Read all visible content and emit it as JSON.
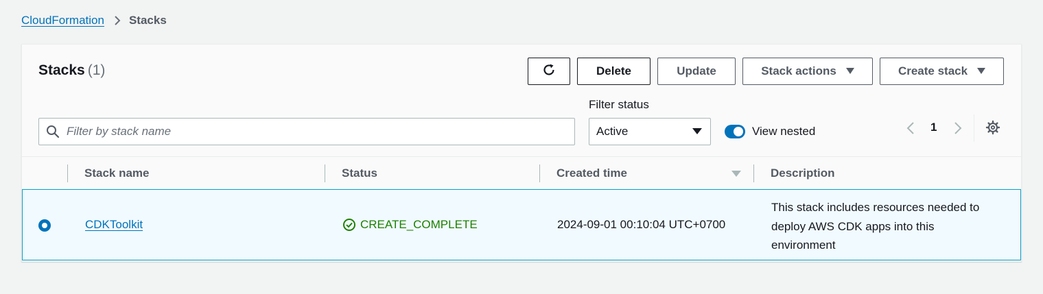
{
  "breadcrumb": {
    "root": "CloudFormation",
    "current": "Stacks"
  },
  "panel": {
    "title": "Stacks",
    "count": "(1)"
  },
  "toolbar": {
    "refresh_icon": "refresh-icon",
    "delete_label": "Delete",
    "update_label": "Update",
    "stack_actions_label": "Stack actions",
    "create_stack_label": "Create stack"
  },
  "filters": {
    "search_placeholder": "Filter by stack name",
    "search_value": "",
    "status_label": "Filter status",
    "status_value": "Active",
    "view_nested_label": "View nested",
    "view_nested_on": true
  },
  "pagination": {
    "current_page": "1"
  },
  "table": {
    "columns": [
      "Stack name",
      "Status",
      "Created time",
      "Description"
    ],
    "sorted_column": "Created time",
    "sort_direction": "descending",
    "rows": [
      {
        "selected": true,
        "name": "CDKToolkit",
        "status": "CREATE_COMPLETE",
        "created": "2024-09-01 00:10:04 UTC+0700",
        "description": "This stack includes resources needed to deploy AWS CDK apps into this environment"
      }
    ]
  },
  "colors": {
    "link": "#0073bb",
    "success": "#1d8102",
    "selected_row_bg": "#f1faff",
    "selected_row_border": "#00a1c9"
  }
}
